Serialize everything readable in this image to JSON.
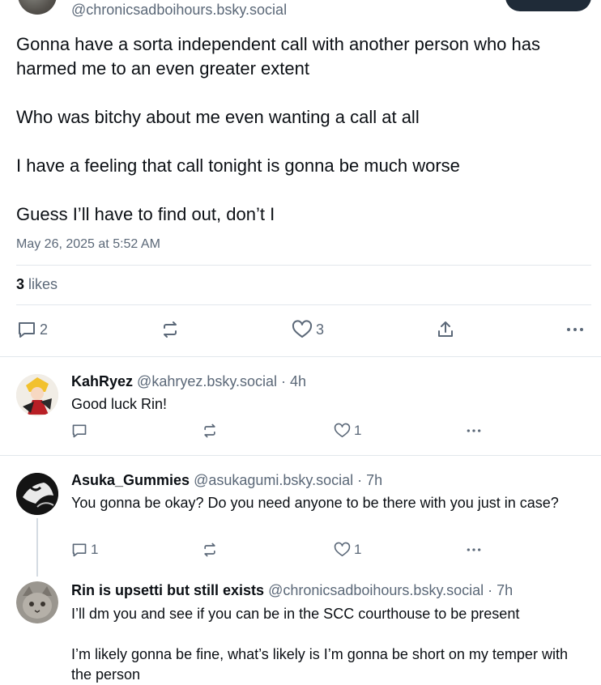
{
  "post": {
    "handle": "@chronicsadboihours.bsky.social",
    "paragraphs": [
      "Gonna have a sorta independent call with another person who has harmed me to an even greater extent",
      "Who was bitchy about me even wanting a call at all",
      "I have a feeling that call tonight is gonna be much worse",
      "Guess I’ll have to find out, don’t I"
    ],
    "timestamp": "May 26, 2025 at 5:52 AM",
    "likes_count": "3",
    "likes_label": "likes",
    "actions": {
      "reply_count": "2",
      "like_count": "3"
    }
  },
  "replies": [
    {
      "display_name": "KahRyez",
      "handle": "@kahryez.bsky.social · 4h",
      "text": [
        "Good luck Rin!"
      ],
      "reply_count": "",
      "like_count": "1"
    },
    {
      "display_name": "Asuka_Gummies",
      "handle": "@asukagumi.bsky.social · 7h",
      "text": [
        "You gonna be okay? Do you need anyone to be there with you just in case?"
      ],
      "reply_count": "1",
      "like_count": "1"
    },
    {
      "display_name": "Rin is upsetti but still exists",
      "handle": "@chronicsadboihours.bsky.social · 7h",
      "text": [
        "I’ll dm you and see if you can be in the SCC courthouse to be present",
        "I’m likely gonna be fine, what’s likely is I’m gonna be short on my temper with the person"
      ]
    }
  ],
  "icons": {
    "reply": "speech-bubble-icon",
    "repost": "repost-arrows-icon",
    "like": "heart-icon",
    "share": "share-icon",
    "more": "ellipsis-icon"
  },
  "colors": {
    "text": "#0b0f14",
    "muted": "#5b6878",
    "divider": "#e2e7ec"
  }
}
